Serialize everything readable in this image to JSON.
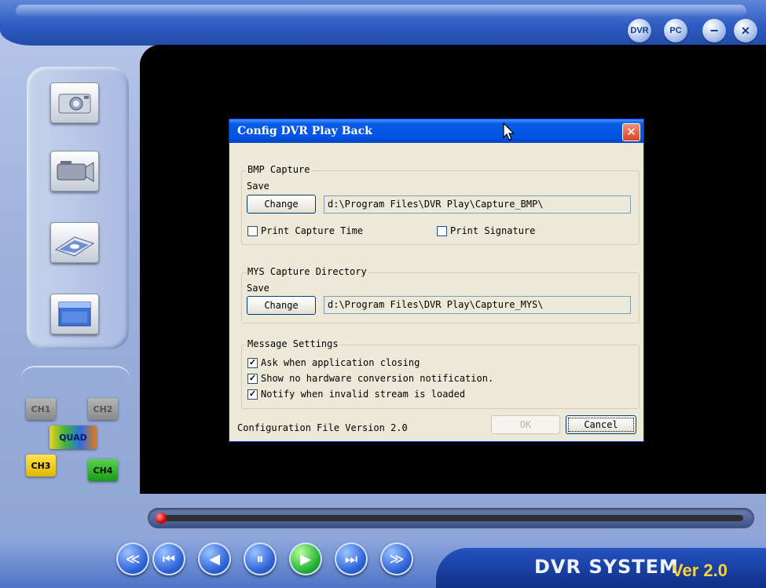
{
  "topbar": {
    "buttons": [
      {
        "name": "dvr-icon",
        "label": "DVR"
      },
      {
        "name": "pc-icon",
        "label": "PC"
      },
      {
        "name": "minimize-icon",
        "label": "−"
      },
      {
        "name": "close-app-icon",
        "label": "✕"
      }
    ]
  },
  "channels": {
    "ch1": "CH1",
    "ch2": "CH2",
    "quad": "QUAD",
    "ch3": "CH3",
    "ch4": "CH4"
  },
  "playback": {
    "progress": 0,
    "buttons": [
      "≪",
      "⏮",
      "◀",
      "⏸",
      "▶",
      "⏭",
      "≫"
    ]
  },
  "brand": {
    "title": "DVR SYSTEM",
    "version": "Ver 2.0"
  },
  "dialog": {
    "title": "Config DVR Play Back",
    "bmp": {
      "group_label": "BMP Capture",
      "save_label": "Save",
      "change_label": "Change",
      "path": "d:\\Program Files\\DVR Play\\Capture_BMP\\",
      "print_time_label": "Print Capture Time",
      "print_time_checked": false,
      "print_signature_label": "Print Signature",
      "print_signature_checked": false
    },
    "mys": {
      "group_label": "MYS Capture Directory",
      "save_label": "Save",
      "change_label": "Change",
      "path": "d:\\Program Files\\DVR Play\\Capture_MYS\\"
    },
    "messages": {
      "group_label": "Message Settings",
      "items": [
        {
          "label": "Ask when application closing",
          "checked": true
        },
        {
          "label": "Show no hardware conversion notification.",
          "checked": true
        },
        {
          "label": "Notify when invalid stream is loaded",
          "checked": true
        }
      ]
    },
    "version_text": "Configuration File Version 2.0",
    "ok_label": "OK",
    "cancel_label": "Cancel"
  }
}
